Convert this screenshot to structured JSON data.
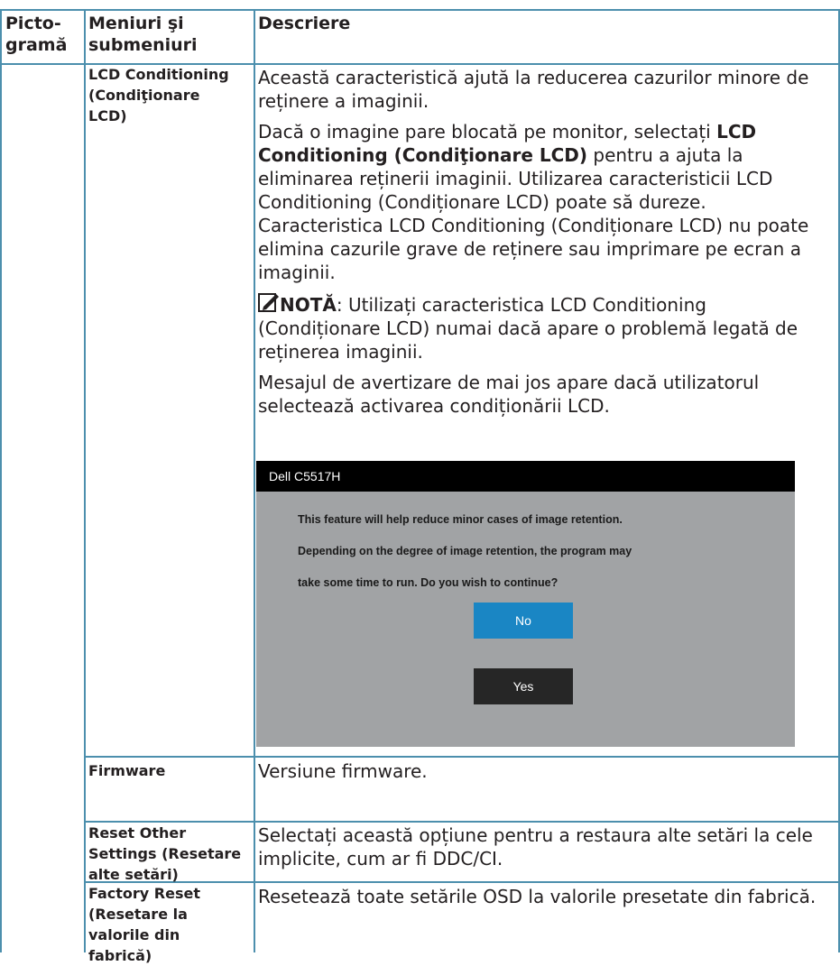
{
  "table": {
    "headers": {
      "icon_col_line1": "Picto-",
      "icon_col_line2": "gramă",
      "menu_col_line1": "Meniuri şi",
      "menu_col_line2": "submeniuri",
      "desc_col": "Descriere"
    },
    "rows": [
      {
        "submenu": [
          "LCD Conditioning",
          "(Condiţionare",
          "LCD)"
        ],
        "paragraphs": [
          "Această caracteristică ajută la reducerea cazurilor minore de reținere a imaginii.",
          "Caracteristica LCD Conditioning (Condiționare LCD) nu poate elimina cazurile grave de reținere sau imprimare pe ecran a imaginii.",
          "Mesajul de avertizare de mai jos apare dacă utilizatorul selectează activarea condiționării LCD."
        ],
        "p2": {
          "part1": "Dacă o imagine pare blocată pe monitor, selectați ",
          "bold": "LCD Conditioning (Condiţionare LCD)",
          "part2": " pentru a ajuta la eliminarea reținerii imaginii. Utilizarea caracteristicii LCD Conditioning (Condiționare LCD) poate să dureze. "
        },
        "note": {
          "label": "NOTĂ",
          "text": ": Utilizați caracteristica LCD Conditioning (Condiționare LCD) numai dacă apare o problemă legată de reținerea imaginii."
        },
        "dialog": {
          "title": "Dell C5517H",
          "lines": [
            "This feature will help reduce minor cases of image retention.",
            "Depending on the degree of image retention, the program may",
            "take some time to run. Do you wish to continue?"
          ],
          "no_label": "No",
          "yes_label": "Yes"
        }
      },
      {
        "submenu": [
          "Firmware"
        ],
        "desc": "Versiune firmware."
      },
      {
        "submenu": [
          "Reset Other",
          "Settings (Resetare",
          "alte setări)"
        ],
        "desc": "Selectați această opțiune pentru a restaura alte setări la cele implicite, cum ar fi DDC/CI."
      },
      {
        "submenu": [
          "Factory Reset",
          "(Resetare la",
          "valorile din",
          "fabrică)"
        ],
        "desc": "Resetează toate setările OSD la valorile presetate din fabrică."
      }
    ]
  },
  "colors": {
    "border": "#4c8fad",
    "dialog_bg": "#a1a3a5",
    "no_button": "#1a86c4",
    "yes_button": "#262626"
  },
  "icons": {
    "note": "pencil-note-icon"
  }
}
